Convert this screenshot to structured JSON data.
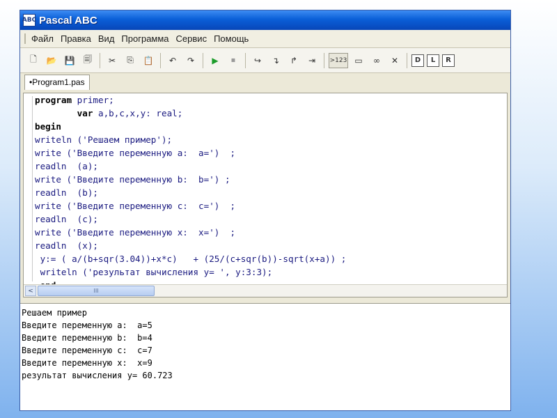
{
  "window": {
    "title": "Pascal ABC",
    "icon_text": "ABC"
  },
  "menu": [
    "Файл",
    "Правка",
    "Вид",
    "Программа",
    "Сервис",
    "Помощь"
  ],
  "toolbar": {
    "icons": [
      "new-file-icon",
      "open-folder-icon",
      "save-icon",
      "save-all-icon",
      "cut-icon",
      "copy-icon",
      "paste-icon",
      "undo-icon",
      "redo-icon",
      "run-icon",
      "stop-icon",
      "step-over-icon",
      "step-into-icon",
      "step-out-icon",
      "run-to-cursor-icon",
      "output-icon",
      "window-icon",
      "watch-icon",
      "close-icon",
      "debug-d-icon",
      "debug-l-icon",
      "debug-r-icon"
    ],
    "glyphs": [
      "🗋",
      "📂",
      "💾",
      "🗐",
      "✂",
      "⎘",
      "📋",
      "↶",
      "↷",
      "▶",
      "⏹",
      "↪",
      "↴",
      "↱",
      "⇥",
      ">123",
      "▭",
      "∞",
      "✕",
      "D",
      "L",
      "R"
    ]
  },
  "tab": {
    "label": "•Program1.pas"
  },
  "code": [
    [
      {
        "t": "program",
        "k": 1
      },
      {
        "t": " primer;"
      }
    ],
    [
      {
        "t": "        "
      },
      {
        "t": "var",
        "k": 1
      },
      {
        "t": " a,b,c,x,y: real;"
      }
    ],
    [
      {
        "t": "begin",
        "k": 1
      }
    ],
    [
      {
        "t": "writeln ('Решаем пример');"
      }
    ],
    [
      {
        "t": "write ('Введите переменную a:  a=')  ;"
      }
    ],
    [
      {
        "t": "readln  (a);"
      }
    ],
    [
      {
        "t": "write ('Введите переменную b:  b=') ;"
      }
    ],
    [
      {
        "t": "readln  (b);"
      }
    ],
    [
      {
        "t": "write ('Введите переменную c:  c=')  ;"
      }
    ],
    [
      {
        "t": "readln  (c);"
      }
    ],
    [
      {
        "t": "write ('Введите переменную x:  x=')  ;"
      }
    ],
    [
      {
        "t": "readln  (x);"
      }
    ],
    [
      {
        "t": " y:= ( a/(b+sqr(3.04))+x*c)   + (25/(c+sqr(b))-sqrt(x+a)) ;"
      }
    ],
    [
      {
        "t": " writeln ('результат вычисления y= ', y:3:3);"
      }
    ],
    [
      {
        "t": " "
      },
      {
        "t": "end.",
        "k": 1
      }
    ]
  ],
  "scrollbar": {
    "left_arrow": "<",
    "thumb_grip": "III"
  },
  "output": [
    "Решаем пример",
    "Введите переменную a:  a=5",
    "Введите переменную b:  b=4",
    "Введите переменную c:  c=7",
    "Введите переменную x:  x=9",
    "результат вычисления y= 60.723"
  ]
}
